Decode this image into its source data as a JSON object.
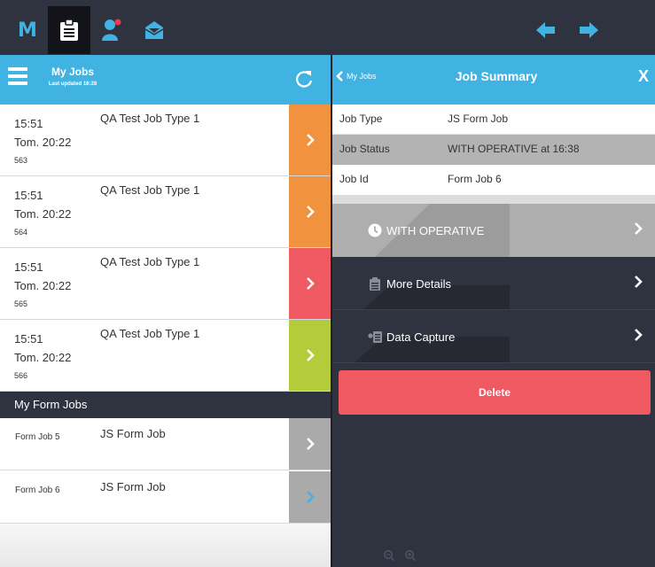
{
  "topbar": {
    "logo": "M",
    "icons": [
      "logo-m-icon",
      "clipboard-icon",
      "user-alert-icon",
      "envelope-icon",
      "arrow-left-icon",
      "arrow-right-icon"
    ],
    "active_icon": "clipboard-icon"
  },
  "colors": {
    "accent": "#41b3e3",
    "dark": "#2f3340",
    "orange": "#f0923e",
    "red": "#ef5a62",
    "green": "#b5cc3a",
    "grey": "#aaaaaa",
    "delete": "#ef5a62"
  },
  "left_panel": {
    "title": "My Jobs",
    "subtitle": "Last updated 16:28",
    "refresh_icon": "refresh-icon",
    "jobs": [
      {
        "time": "15:51",
        "due": "Tom. 20:22",
        "number": "563",
        "title": "QA Test Job Type 1",
        "status_color": "#f0923e"
      },
      {
        "time": "15:51",
        "due": "Tom. 20:22",
        "number": "564",
        "title": "QA Test Job Type 1",
        "status_color": "#f0923e"
      },
      {
        "time": "15:51",
        "due": "Tom. 20:22",
        "number": "565",
        "title": "QA Test Job Type 1",
        "status_color": "#ef5a62"
      },
      {
        "time": "15:51",
        "due": "Tom. 20:22",
        "number": "566",
        "title": "QA Test Job Type 1",
        "status_color": "#b5cc3a"
      }
    ],
    "form_section_title": "My Form Jobs",
    "form_jobs": [
      {
        "id": "Form Job 5",
        "title": "JS Form Job"
      },
      {
        "id": "Form Job 6",
        "title": "JS Form Job"
      }
    ]
  },
  "right_panel": {
    "back_label": "My Jobs",
    "title": "Job Summary",
    "close_label": "X",
    "summary": [
      {
        "label": "Job Type",
        "value": "JS Form Job"
      },
      {
        "label": "Job Status",
        "value": "WITH OPERATIVE at 16:38"
      },
      {
        "label": "Job Id",
        "value": "Form Job 6"
      }
    ],
    "actions": [
      {
        "label": "WITH OPERATIVE",
        "icon": "clock-icon"
      },
      {
        "label": "More Details",
        "icon": "clipboard-icon"
      },
      {
        "label": "Data Capture",
        "icon": "data-capture-icon"
      }
    ],
    "delete_label": "Delete",
    "zoom_icons": [
      "zoom-out-icon",
      "zoom-in-icon"
    ]
  }
}
